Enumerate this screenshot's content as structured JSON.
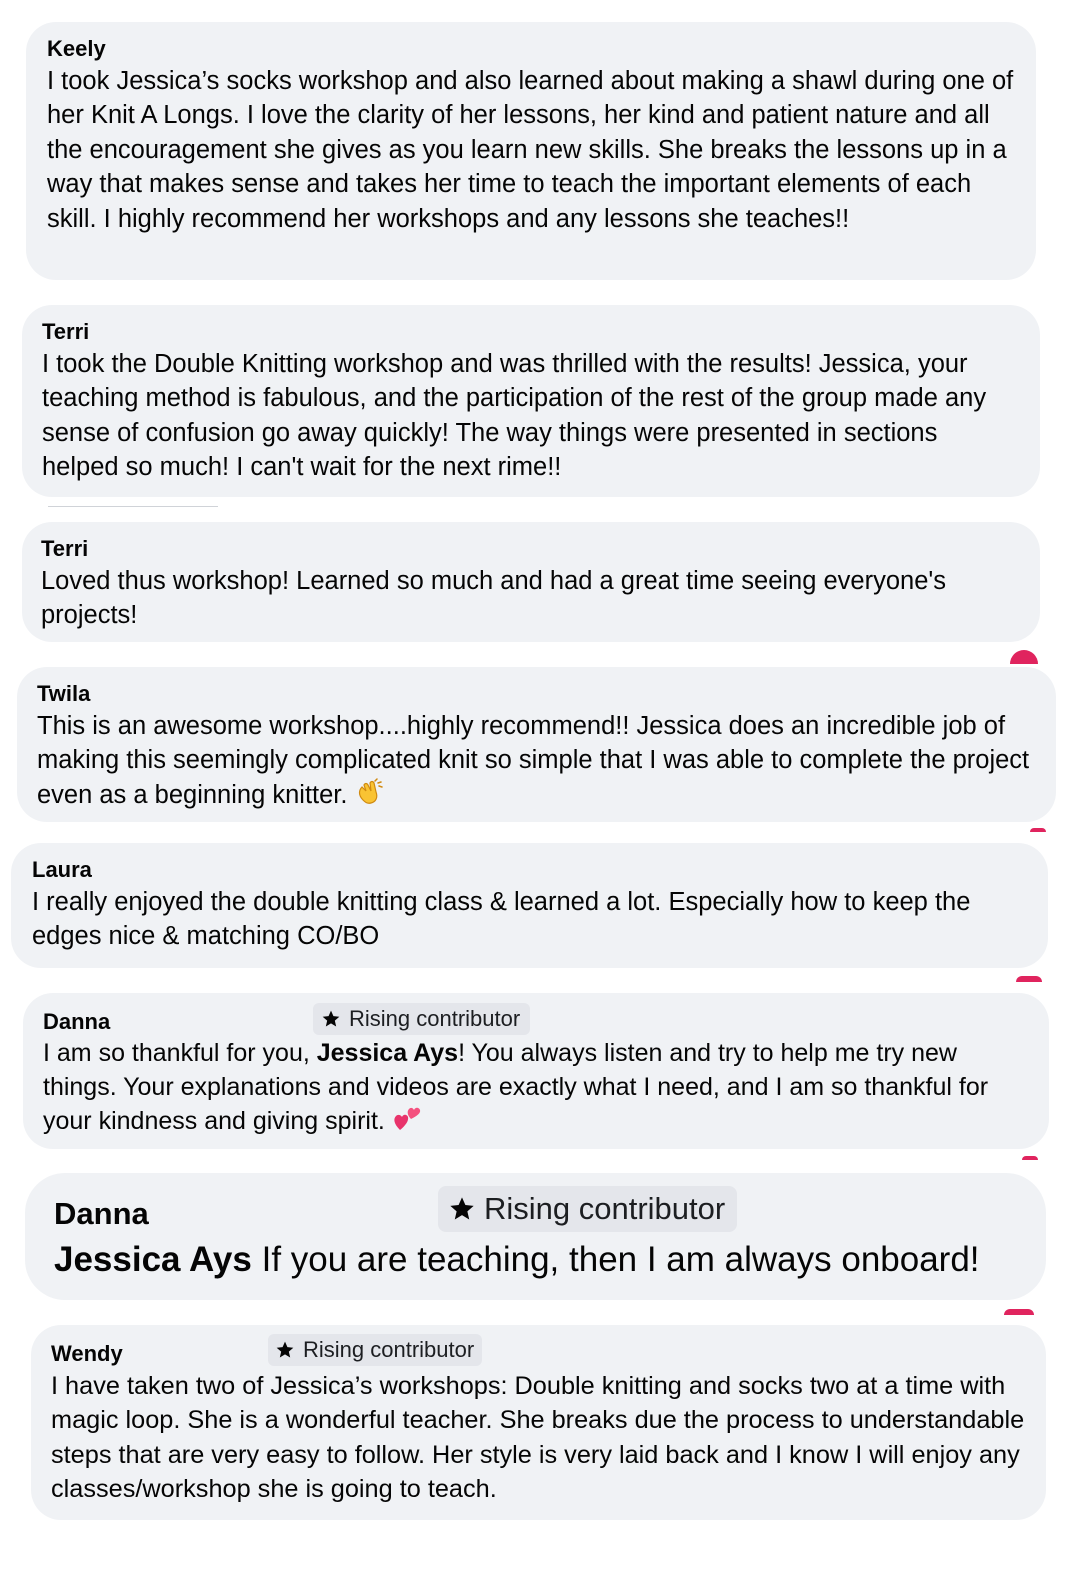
{
  "comments": [
    {
      "name": "Keely",
      "text": "I took Jessica’s socks workshop and also learned about making a shawl during one of her Knit A Longs. I love the clarity of her lessons, her kind and patient nature and all the encouragement she gives as you learn new skills. She breaks the lessons up in a way that makes sense and takes her time to teach the important elements of each skill. I highly recommend her workshops and any lessons she teaches!!"
    },
    {
      "name": "Terri",
      "text": "I took the Double Knitting workshop and was thrilled with the results! Jessica, your teaching method is fabulous, and the participation of the rest of the group made any sense of confusion go away quickly! The way things were presented in sections helped so much! I can't wait for the next rime!!"
    },
    {
      "name": "Terri",
      "text": "Loved thus workshop! Learned so much and had a great time seeing everyone's projects!"
    },
    {
      "name": "Twila",
      "text": "This is an awesome workshop....highly recommend!! Jessica does an incredible job of making this seemingly complicated knit so simple that I was able to complete the project even as a beginning knitter.",
      "emoji": "clapping-hands-emoji"
    },
    {
      "name": "Laura",
      "text": "I really enjoyed the double knitting class & learned a lot. Especially how to keep the edges nice & matching CO/BO"
    },
    {
      "name": "Danna",
      "badge": "Rising contributor",
      "text_before": "I am so thankful for you,",
      "mention": "Jessica Ays",
      "text_after": "! You always listen and try to help me try new things. Your explanations and videos are exactly what I need, and I am so thankful for your kindness and giving spirit.",
      "emoji": "two-hearts-emoji"
    },
    {
      "name": "Danna",
      "badge": "Rising contributor",
      "mention": "Jessica Ays",
      "text_after": "If you are teaching, then I am always onboard!"
    },
    {
      "name": "Wendy",
      "badge": "Rising contributor",
      "text": "I have taken two of Jessica’s workshops: Double knitting and socks two at a time with magic loop. She is a wonderful teacher. She breaks due the process to understandable steps that are very easy to follow. Her style is very laid back and I know I will enjoy any classes/workshop she is going to teach."
    }
  ],
  "colors": {
    "bubble": "#f0f2f5",
    "badge": "#e4e6eb",
    "reaction": "#e0245e",
    "text": "#050505"
  }
}
